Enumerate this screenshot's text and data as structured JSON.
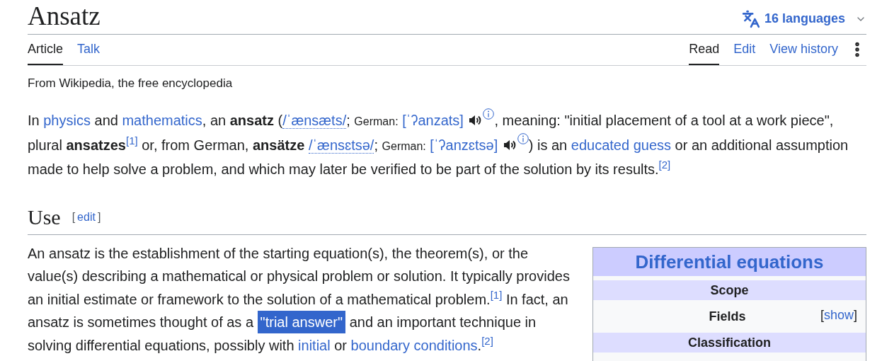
{
  "title": "Ansatz",
  "languages": "16 languages",
  "left_tabs": [
    {
      "label": "Article",
      "selected": true
    },
    {
      "label": "Talk",
      "selected": false
    }
  ],
  "right_tabs": [
    {
      "label": "Read",
      "selected": true
    },
    {
      "label": "Edit",
      "selected": false
    },
    {
      "label": "View history",
      "selected": false
    }
  ],
  "tagline": "From Wikipedia, the free encyclopedia",
  "intro": [
    {
      "kind": "text",
      "text": "In "
    },
    {
      "kind": "link",
      "text": "physics"
    },
    {
      "kind": "text",
      "text": " and "
    },
    {
      "kind": "link",
      "text": "mathematics"
    },
    {
      "kind": "text",
      "text": ", an "
    },
    {
      "kind": "bold",
      "text": "ansatz"
    },
    {
      "kind": "text",
      "text": " ("
    },
    {
      "kind": "ipa",
      "text": "/ˈænsæts/"
    },
    {
      "kind": "text",
      "text": "; "
    },
    {
      "kind": "small",
      "text": "German:"
    },
    {
      "kind": "space"
    },
    {
      "kind": "link",
      "text": "[ˈʔanzats]"
    },
    {
      "kind": "space"
    },
    {
      "kind": "audio"
    },
    {
      "kind": "info"
    },
    {
      "kind": "text",
      "text": ", meaning: \"initial placement of a tool at a work piece\", plural "
    },
    {
      "kind": "bold",
      "text": "ansatzes"
    },
    {
      "kind": "ref",
      "text": "[1]"
    },
    {
      "kind": "text",
      "text": " or, from German, "
    },
    {
      "kind": "bold",
      "text": "ansätze"
    },
    {
      "kind": "space"
    },
    {
      "kind": "ipa",
      "text": "/ˈænsɛtsə/"
    },
    {
      "kind": "text",
      "text": "; "
    },
    {
      "kind": "small",
      "text": "German:"
    },
    {
      "kind": "space"
    },
    {
      "kind": "link",
      "text": "[ˈʔanzɛtsə]"
    },
    {
      "kind": "space"
    },
    {
      "kind": "audio"
    },
    {
      "kind": "info"
    },
    {
      "kind": "text",
      "text": ") is an "
    },
    {
      "kind": "link",
      "text": "educated guess"
    },
    {
      "kind": "text",
      "text": " or an additional assumption made to help solve a problem, and which may later be verified to be part of the solution by its results."
    },
    {
      "kind": "ref",
      "text": "[2]"
    }
  ],
  "section": {
    "heading": "Use",
    "edit_open": "[",
    "edit": "edit",
    "edit_close": "]"
  },
  "use": [
    {
      "kind": "text",
      "text": "An ansatz is the establishment of the starting equation(s), the theorem(s), or the value(s) describing a mathematical or physical problem or solution. It typically provides an initial estimate or framework to the solution of a mathematical problem."
    },
    {
      "kind": "ref",
      "text": "[1]"
    },
    {
      "kind": "text",
      "text": " In fact, an ansatz is sometimes thought of as a "
    },
    {
      "kind": "highlight",
      "text": "\"trial answer\""
    },
    {
      "kind": "text",
      "text": " and an important technique in solving differential equations, possibly with "
    },
    {
      "kind": "link",
      "text": "initial"
    },
    {
      "kind": "text",
      "text": " or "
    },
    {
      "kind": "link",
      "text": "boundary conditions"
    },
    {
      "kind": "text",
      "text": "."
    },
    {
      "kind": "ref",
      "text": "[2]"
    }
  ],
  "infobox": {
    "title": "Differential equations",
    "rows": [
      {
        "kind": "header",
        "label": "Scope"
      },
      {
        "kind": "toggle",
        "label": "Fields",
        "open": "[",
        "action": "show",
        "close": "]"
      },
      {
        "kind": "header",
        "label": "Classification"
      },
      {
        "kind": "blank"
      }
    ]
  }
}
